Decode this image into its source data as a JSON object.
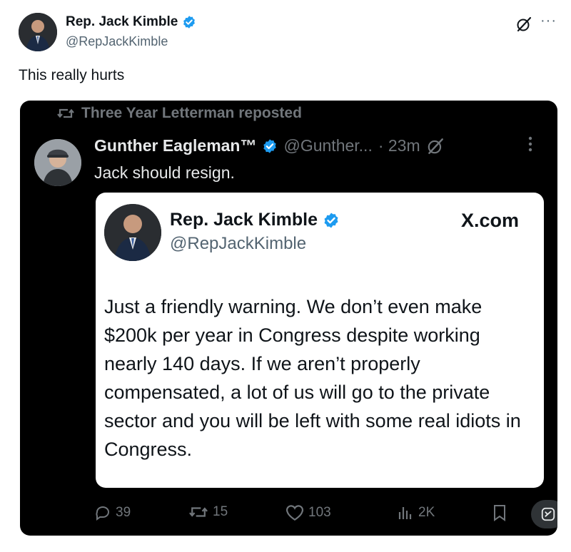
{
  "outer_post": {
    "author_name": "Rep. Jack Kimble",
    "handle": "@RepJackKimble",
    "text": "This really hurts",
    "more_label": "···"
  },
  "embedded": {
    "repost_label": "Three Year Letterman reposted",
    "inner_post": {
      "author_name": "Gunther Eagleman™",
      "handle": "@Gunther...",
      "time": "· 23m",
      "text": "Jack should resign.",
      "more_label": "⋮"
    },
    "screenshot": {
      "author_name": "Rep. Jack Kimble",
      "handle": "@RepJackKimble",
      "source": "X.com",
      "text": "Just a friendly warning. We don’t even make $200k per year in Congress despite working nearly 140 days.  If we aren’t properly compensated, a lot of us will go to the private sector and you will be left with some real idiots in Congress."
    },
    "actions": {
      "replies": "39",
      "reposts": "15",
      "likes": "103",
      "views": "2K"
    }
  },
  "colors": {
    "verified_blue": "#1d9bf0",
    "dark_bg": "#000000",
    "muted_text": "#71767b"
  },
  "icons": [
    "verified-badge-icon",
    "grok-icon",
    "more-icon",
    "repost-icon",
    "reply-icon",
    "like-icon",
    "views-icon",
    "bookmark-icon"
  ]
}
